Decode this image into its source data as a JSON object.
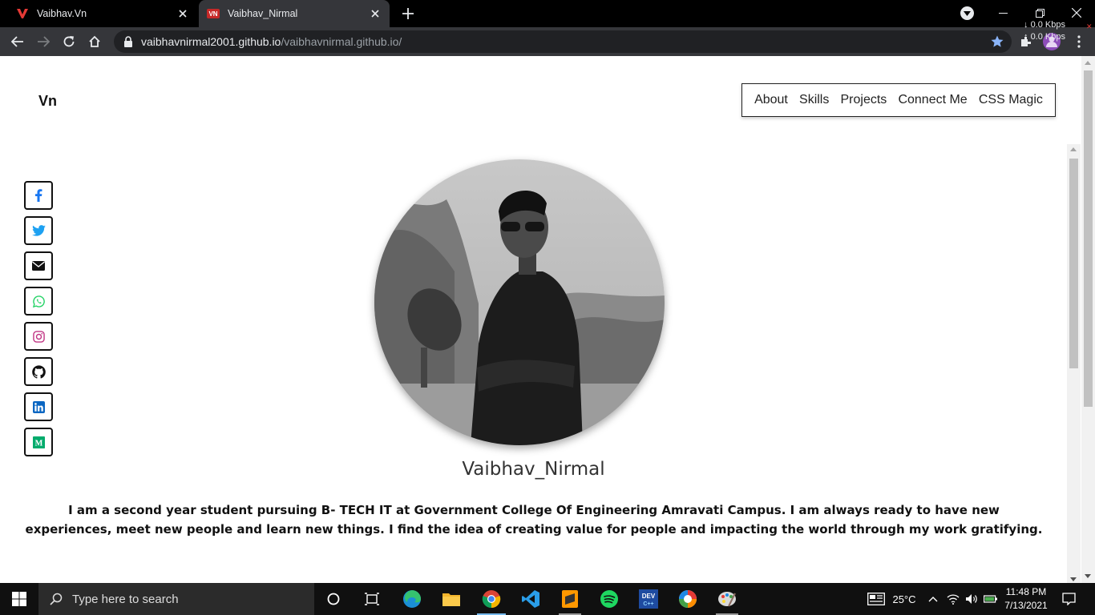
{
  "browser": {
    "tabs": [
      {
        "title": "Vaibhav.Vn",
        "active": false
      },
      {
        "title": "Vaibhav_Nirmal",
        "active": true
      }
    ],
    "url_host": "vaibhavnirmal2001.github.io",
    "url_path": "/vaibhavnirmal.github.io/",
    "net_down": "0.0 Kbps",
    "net_up": "0.0 Kbps"
  },
  "page": {
    "logo": "Vn",
    "nav": [
      "About",
      "Skills",
      "Projects",
      "Connect Me",
      "CSS Magic"
    ],
    "social_icons": [
      "facebook-icon",
      "twitter-icon",
      "email-icon",
      "whatsapp-icon",
      "instagram-icon",
      "github-icon",
      "linkedin-icon",
      "medium-icon"
    ],
    "name": "Vaibhav_Nirmal",
    "bio": "I am a second year student pursuing B- TECH IT at Government College Of Engineering Amravati Campus. I am always ready to have new experiences, meet new people and learn new things. I find the idea of creating value for people and impacting the world through my work gratifying."
  },
  "taskbar": {
    "search_placeholder": "Type here to search",
    "temperature": "25°C",
    "time": "11:48 PM",
    "date": "7/13/2021"
  },
  "colors": {
    "facebook": "#1877f2",
    "twitter": "#1da1f2",
    "whatsapp": "#25d366",
    "instagram": "#c13584",
    "linkedin": "#0a66c2",
    "medium": "#00ab6c",
    "accent": "#8ab4f8"
  }
}
